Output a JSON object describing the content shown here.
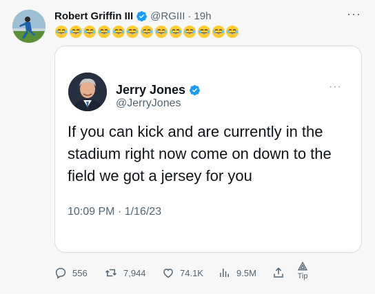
{
  "tweet": {
    "author_name": "Robert Griffin III",
    "author_handle": "@RGIII",
    "separator": "·",
    "time": "19h",
    "more_label": "···",
    "emoji_text": "😂😂😂😂😂😂😂😂😂😂😂😂😂",
    "emoji_count": 13
  },
  "quote": {
    "author_name": "Jerry Jones",
    "author_handle": "@JerryJones",
    "more_label": "···",
    "text": "If you can kick and are currently in the stadium right now come on down to the field we got a jersey for you",
    "date": "10:09 PM · 1/16/23"
  },
  "actions": {
    "replies": "556",
    "retweets": "7,944",
    "likes": "74.1K",
    "views": "9.5M",
    "tip_label": "Tip"
  },
  "colors": {
    "verified": "#1d9bf0",
    "muted": "#536471",
    "border": "#d9dde0"
  },
  "icons": [
    "verified-badge-icon",
    "more-icon",
    "reply-icon",
    "retweet-icon",
    "like-icon",
    "views-icon",
    "share-icon",
    "tip-icon"
  ]
}
